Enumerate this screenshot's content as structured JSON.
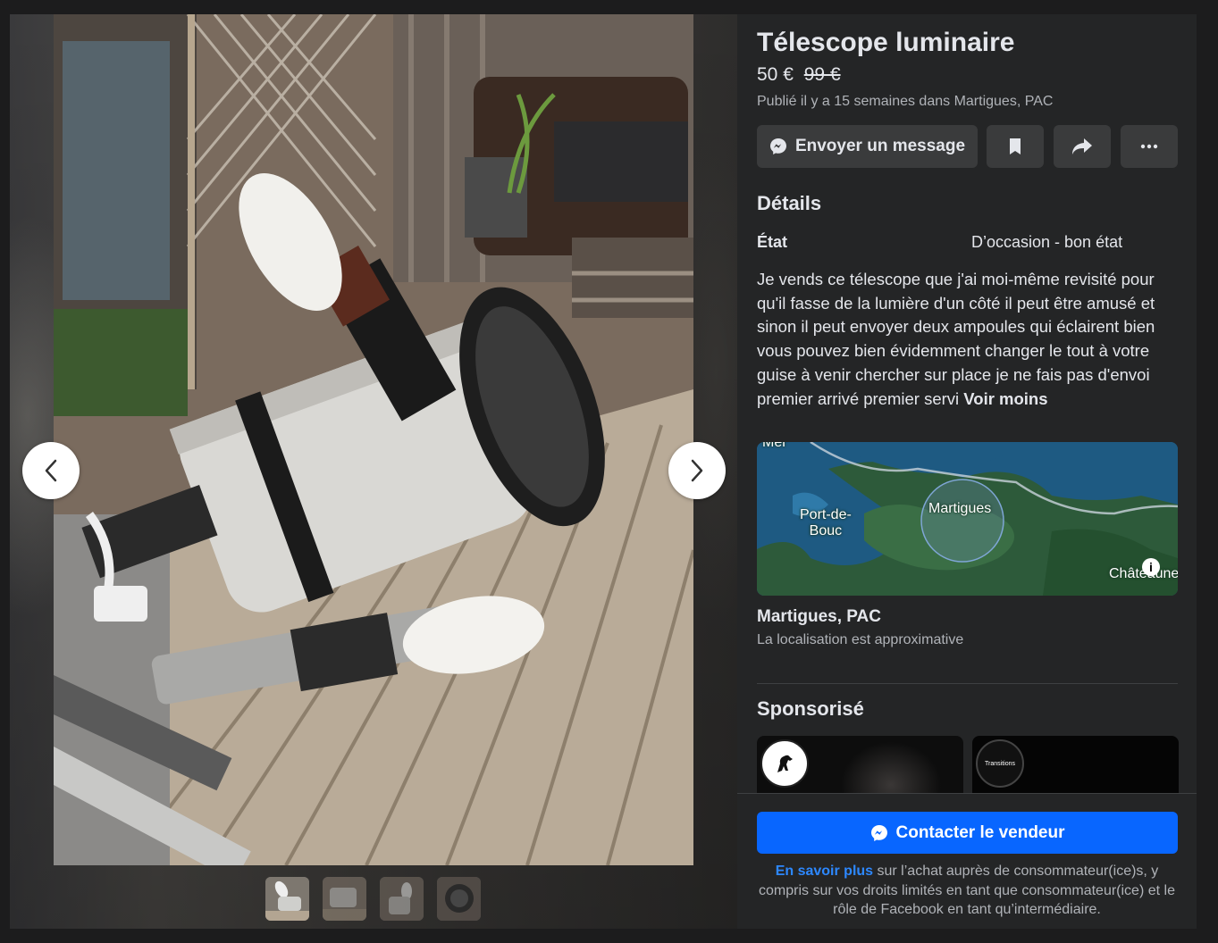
{
  "listing": {
    "title": "Télescope luminaire",
    "price": "50 €",
    "original_price": "99 €",
    "meta": "Publié il y a 15 semaines dans Martigues, PAC"
  },
  "actions": {
    "message_label": "Envoyer un message",
    "save_icon": "bookmark-icon",
    "share_icon": "share-arrow-icon",
    "more_icon": "more-dots-icon"
  },
  "details": {
    "heading": "Détails",
    "condition_label": "État",
    "condition_value": "D’occasion - bon état",
    "description": "Je vends ce télescope que j'ai moi-même revisité pour qu'il fasse de la lumière d'un côté il peut être amusé et sinon il peut envoyer deux ampoules qui éclairent bien vous pouvez bien évidemment changer le tout à votre guise à venir chercher sur place je ne fais pas d'envoi premier arrivé premier servi",
    "toggle_label": "Voir moins"
  },
  "map": {
    "labels": {
      "top": "Mer",
      "port": "Port-de-\nBouc",
      "city": "Martigues",
      "east": "Châteaune"
    }
  },
  "location": {
    "city": "Martigues, PAC",
    "note": "La localisation est approximative"
  },
  "sponsored": {
    "heading": "Sponsorisé",
    "ads": [
      {
        "logo": "horse-logo-icon"
      },
      {
        "logo_text": "Transitions"
      }
    ]
  },
  "footer": {
    "contact_label": "Contacter le vendeur",
    "legal_link": "En savoir plus",
    "legal_text": " sur l’achat auprès de consommateur(ice)s, y compris sur vos droits limités en tant que consommateur(ice) et le rôle de Facebook en tant qu’intermédiaire."
  },
  "gallery": {
    "photo_count": 4,
    "active_index": 0
  },
  "colors": {
    "panel_bg": "#242526",
    "button_bg": "#3a3b3c",
    "accent": "#0866ff",
    "secondary_text": "#b0b3b8"
  }
}
